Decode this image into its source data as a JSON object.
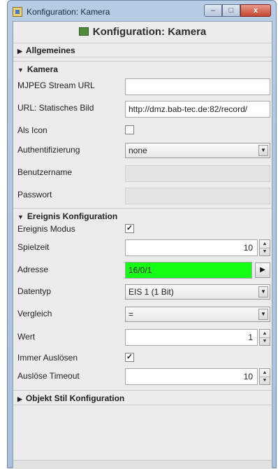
{
  "window": {
    "title": "Konfiguration: Kamera",
    "minimize": "–",
    "maximize": "□",
    "close": "x"
  },
  "header": {
    "title": "Konfiguration: Kamera"
  },
  "sections": {
    "allgemeines": {
      "label": "Allgemeines",
      "expanded": false
    },
    "kamera": {
      "label": "Kamera",
      "expanded": true
    },
    "ereignis": {
      "label": "Ereignis Konfiguration",
      "expanded": true
    },
    "objekt_stil": {
      "label": "Objekt Stil Konfiguration",
      "expanded": false
    }
  },
  "kamera": {
    "mjpeg_label": "MJPEG Stream URL",
    "mjpeg_value": "",
    "static_label": "URL: Statisches Bild",
    "static_value": "http://dmz.bab-tec.de:82/record/",
    "icon_label": "Als Icon",
    "icon_checked": false,
    "auth_label": "Authentifizierung",
    "auth_value": "none",
    "user_label": "Benutzername",
    "user_value": "",
    "pass_label": "Passwort",
    "pass_value": ""
  },
  "ereignis": {
    "modus_label": "Ereignis Modus",
    "modus_checked": true,
    "spielzeit_label": "Spielzeit",
    "spielzeit_value": "10",
    "adresse_label": "Adresse",
    "adresse_value": "16/0/1",
    "datentyp_label": "Datentyp",
    "datentyp_value": "EIS 1 (1 Bit)",
    "vergleich_label": "Vergleich",
    "vergleich_value": "=",
    "wert_label": "Wert",
    "wert_value": "1",
    "immer_label": "Immer Auslösen",
    "immer_checked": true,
    "timeout_label": "Auslöse Timeout",
    "timeout_value": "10"
  },
  "glyphs": {
    "expanded": "▼",
    "collapsed": "▶",
    "check": "✓",
    "combo_arrow": "▼",
    "spin_up": "▲",
    "spin_down": "▼",
    "play": "▶"
  },
  "colors": {
    "address_highlight": "#14ff14"
  }
}
